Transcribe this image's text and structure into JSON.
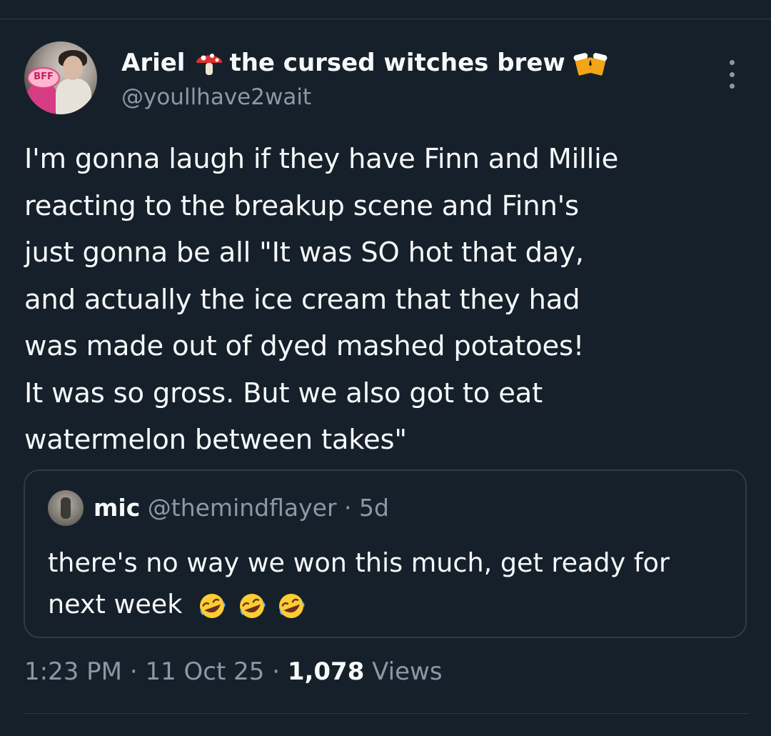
{
  "tweet": {
    "author": {
      "name_part1": "Ariel",
      "name_part2": "the cursed witches brew",
      "handle": "@youllhave2wait",
      "avatar_badge": "BFF"
    },
    "text_lines": [
      "I'm gonna laugh if they have Finn and Millie",
      "reacting to the breakup scene and Finn's",
      "just gonna be all \"It was SO hot that day,",
      "and actually the ice cream that they had",
      "was made out of dyed mashed potatoes!",
      "It was so gross. But we also got to eat",
      "watermelon between takes\""
    ],
    "icons": {
      "name_emoji_1": "mushroom-emoji",
      "name_emoji_2": "beer-mugs-emoji",
      "more": "more-vertical-icon"
    }
  },
  "quote": {
    "name": "mic",
    "handle": "@themindflayer",
    "separator": "·",
    "age": "5d",
    "text_lines": [
      "there's no way we won this much, get ready for",
      "next week"
    ],
    "emoji": [
      "rolling-on-floor-laughing",
      "rolling-on-floor-laughing",
      "rolling-on-floor-laughing"
    ]
  },
  "footer": {
    "time": "1:23 PM",
    "sep1": "·",
    "date": "11 Oct 25",
    "sep2": "·",
    "views_count": "1,078",
    "views_label": "Views"
  },
  "colors": {
    "background": "#15202b",
    "text": "#f7f9f9",
    "secondary": "#8b98a5",
    "border": "#2f3b47"
  }
}
